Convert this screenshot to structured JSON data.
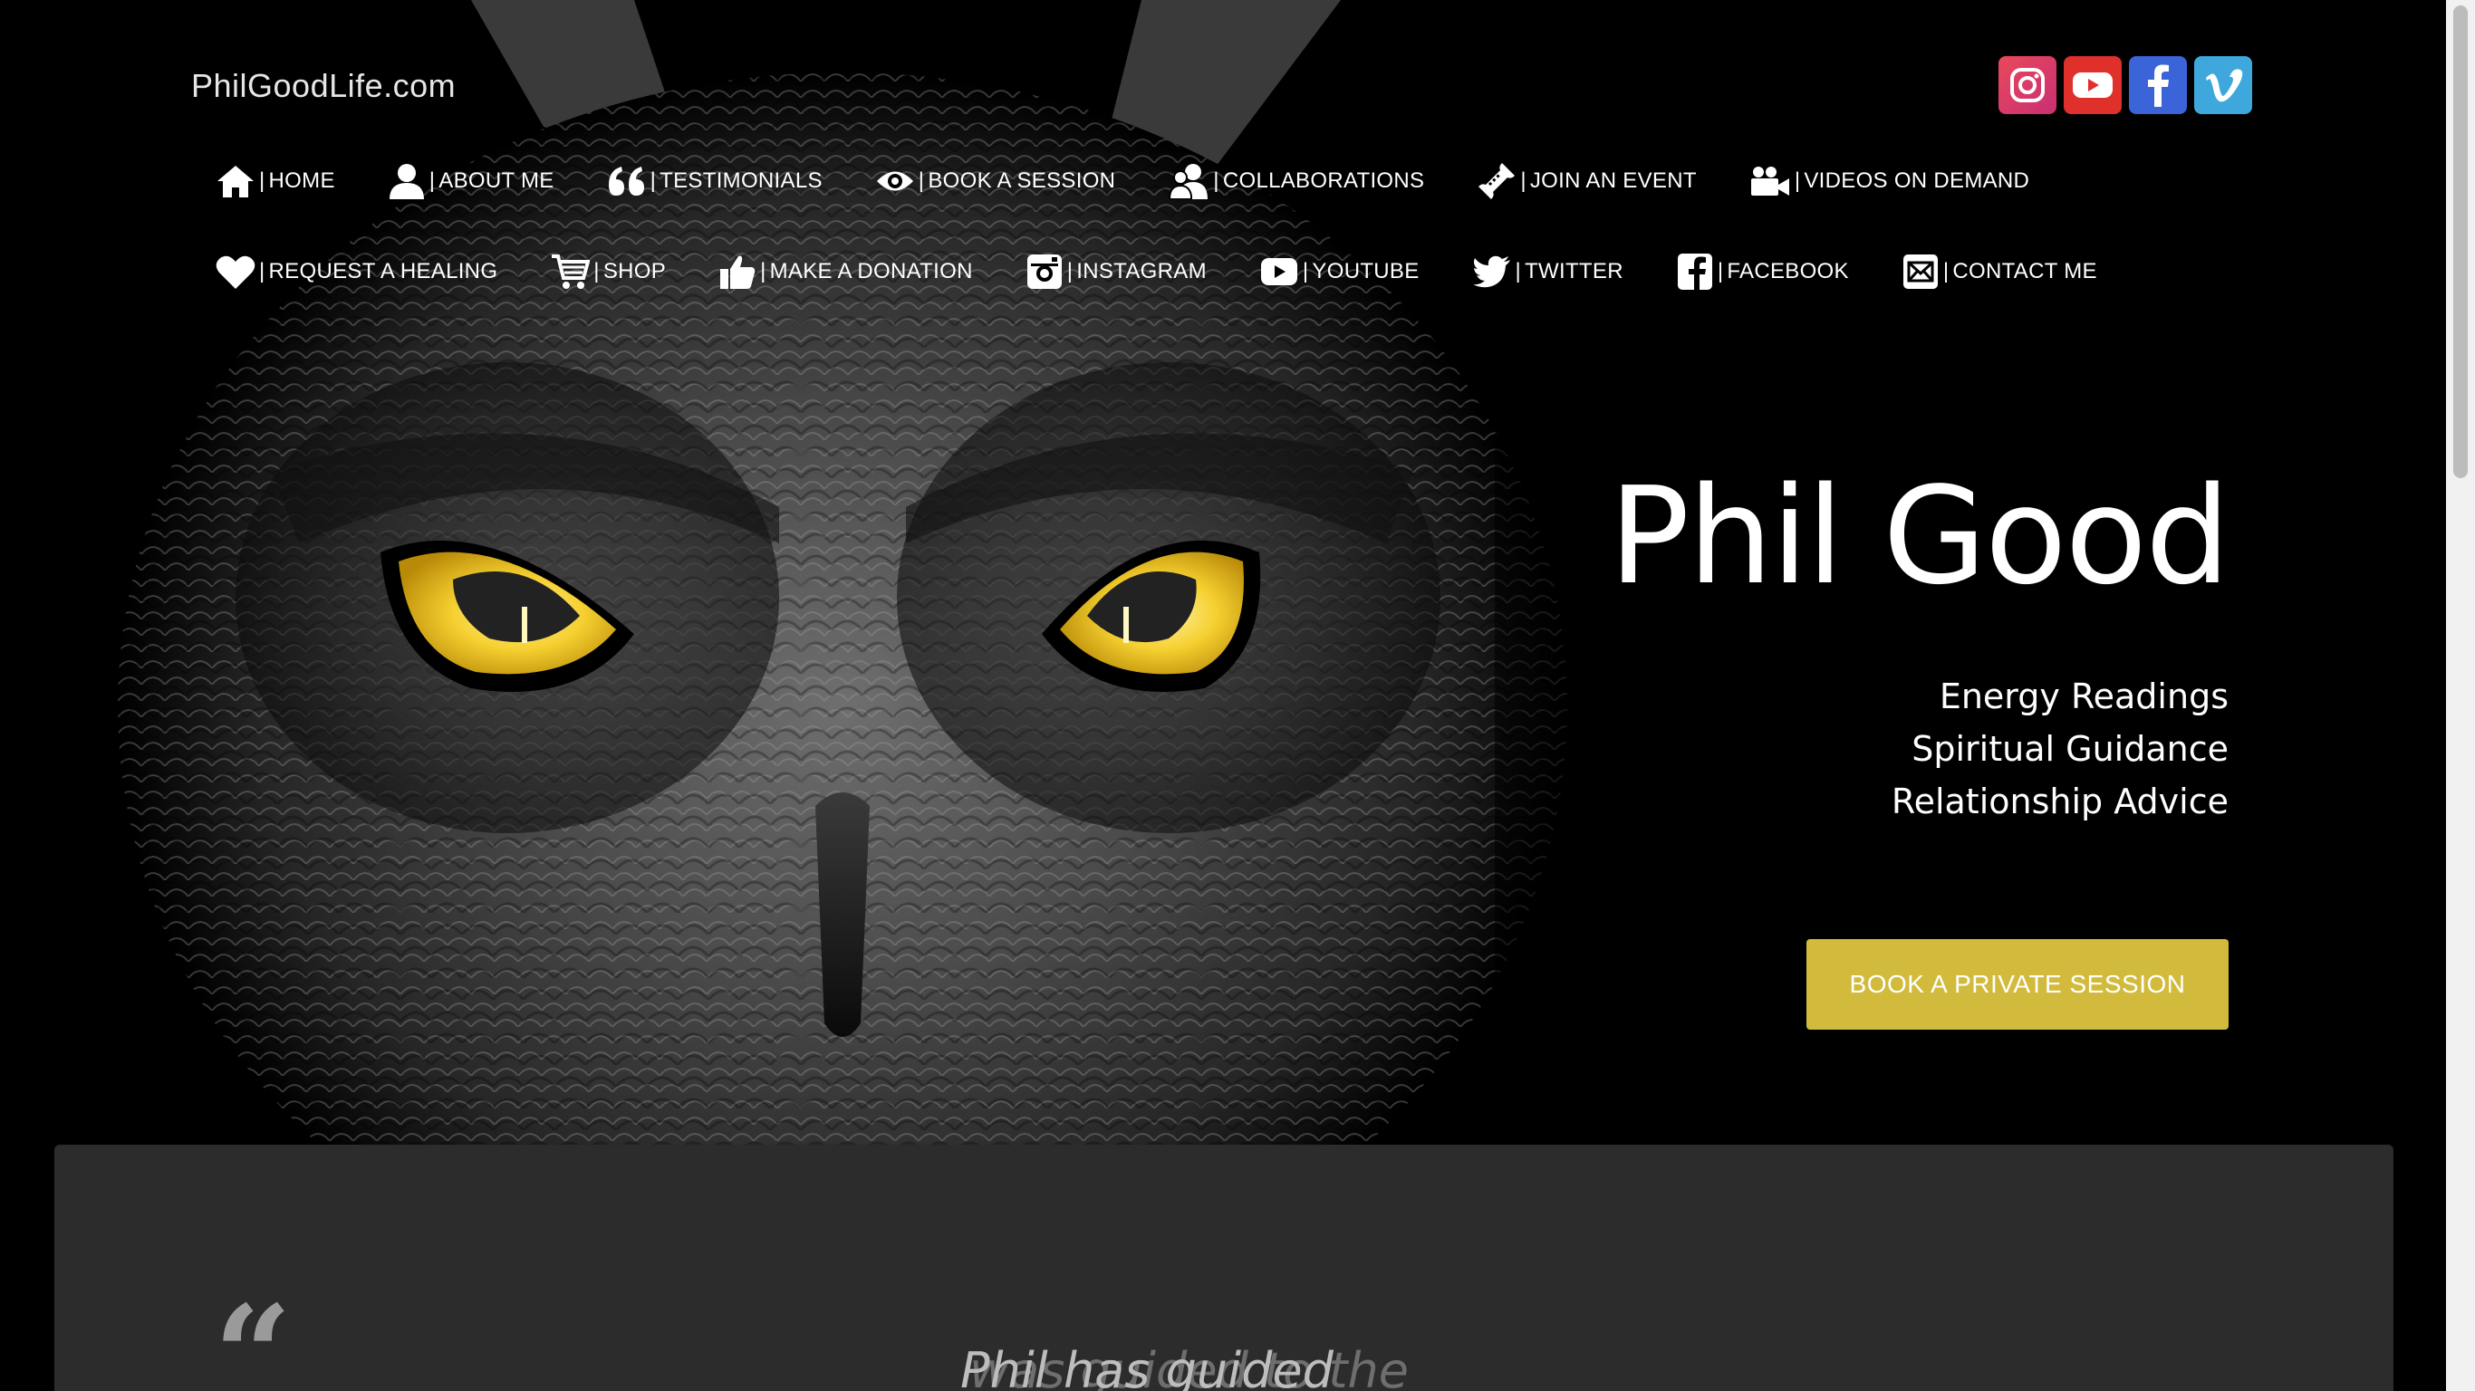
{
  "site": {
    "brand": "PhilGoodLife.com"
  },
  "social_icons": [
    {
      "name": "instagram-icon",
      "color": "#e1306c"
    },
    {
      "name": "youtube-icon",
      "color": "#e0302b"
    },
    {
      "name": "facebook-icon",
      "color": "#3b64d9"
    },
    {
      "name": "vimeo-icon",
      "color": "#3ea8dc"
    }
  ],
  "nav": {
    "separator": "|",
    "row1": [
      {
        "label": "HOME",
        "icon": "home-icon"
      },
      {
        "label": "ABOUT ME",
        "icon": "person-icon"
      },
      {
        "label": "TESTIMONIALS",
        "icon": "quote-icon"
      },
      {
        "label": "BOOK A SESSION",
        "icon": "eye-icon"
      },
      {
        "label": "COLLABORATIONS",
        "icon": "users-icon"
      },
      {
        "label": "JOIN AN EVENT",
        "icon": "ticket-icon"
      },
      {
        "label": "VIDEOS ON DEMAND",
        "icon": "video-camera-icon"
      }
    ],
    "row2": [
      {
        "label": "REQUEST A HEALING",
        "icon": "heart-icon"
      },
      {
        "label": "SHOP",
        "icon": "cart-icon"
      },
      {
        "label": "MAKE A DONATION",
        "icon": "thumbs-up-icon"
      },
      {
        "label": "INSTAGRAM",
        "icon": "instagram-icon"
      },
      {
        "label": "YOUTUBE",
        "icon": "youtube-icon"
      },
      {
        "label": "TWITTER",
        "icon": "twitter-icon"
      },
      {
        "label": "FACEBOOK",
        "icon": "facebook-icon"
      },
      {
        "label": "CONTACT ME",
        "icon": "envelope-icon"
      }
    ]
  },
  "hero": {
    "title": "Phil Good",
    "services": [
      "Energy Readings",
      "Spiritual Guidance",
      "Relationship Advice"
    ],
    "cta_label": "BOOK A PRIVATE SESSION",
    "accent_color": "#d2bb3c",
    "eye_color": "#f2c531"
  },
  "testimonials": {
    "quote_mark": "“",
    "quote_text_a": "Phil has guided",
    "quote_text_b": "was guided to the"
  }
}
